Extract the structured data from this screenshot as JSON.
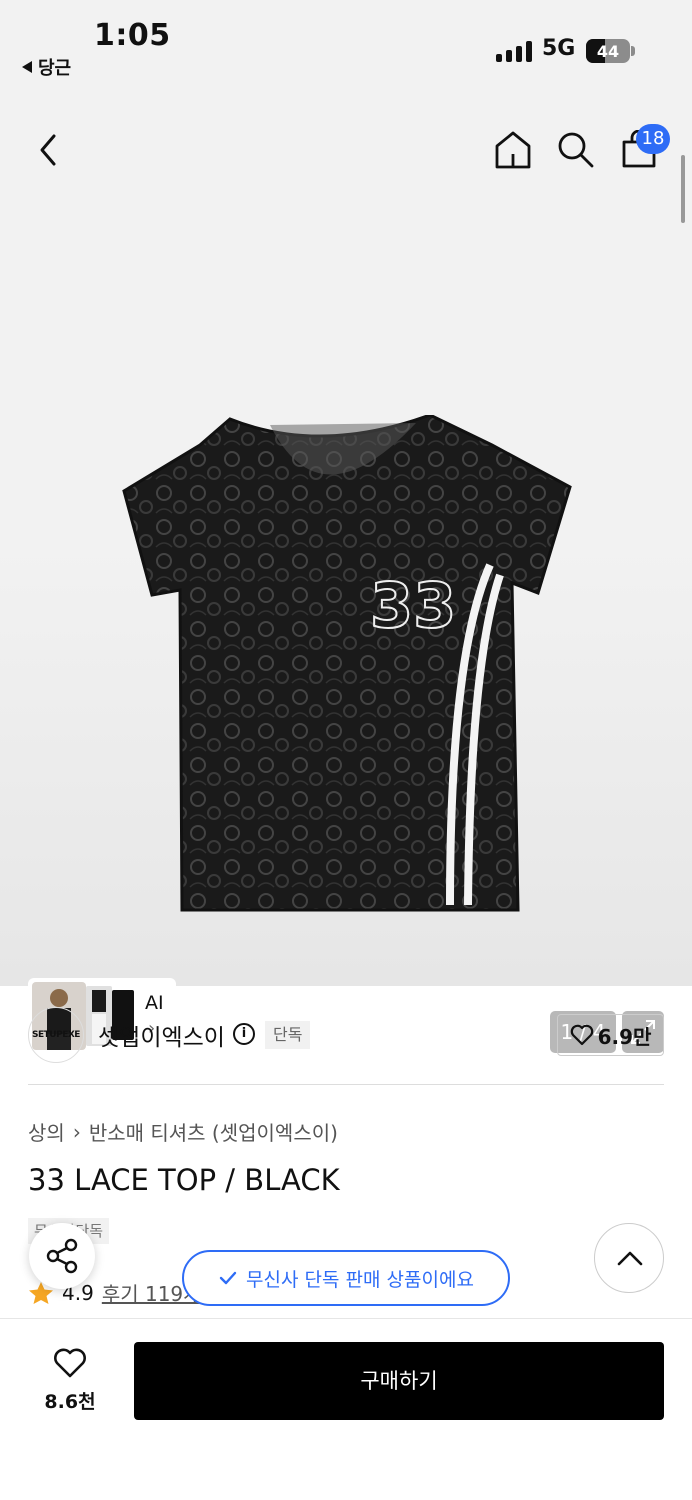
{
  "status_bar": {
    "time": "1:05",
    "back_app": "당근",
    "network": "5G",
    "battery": "44",
    "battery_level": 0.44
  },
  "header": {
    "cart_count": "18"
  },
  "gallery": {
    "ai_label": "AI",
    "pager": "1 / 4"
  },
  "brand": {
    "logo_text": "SETUPEXE",
    "name": "셋업이엑스이",
    "exclusive_tag": "단독",
    "likes": "6.9만"
  },
  "breadcrumb": {
    "category": "상의",
    "subcategory": "반소매 티셔츠 (셋업이엑스이)"
  },
  "product": {
    "title": "33 LACE TOP / BLACK",
    "tag": "무신사단독",
    "rating": "4.9",
    "reviews": "후기 119개"
  },
  "toast": {
    "text": "무신사 단독 판매 상품이에요"
  },
  "bottom": {
    "wish_count": "8.6천",
    "buy_label": "구매하기"
  },
  "colors": {
    "accent": "#2e6cf6",
    "buy": "#000000",
    "star": "#f5a623"
  }
}
